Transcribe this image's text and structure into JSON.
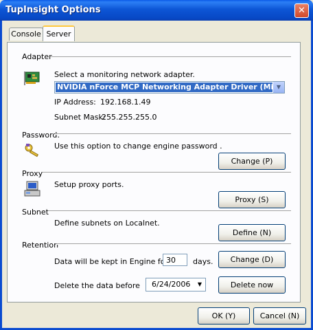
{
  "window": {
    "title": "TupInsight Options",
    "close_glyph": "✕"
  },
  "tabs": [
    {
      "label": "Console"
    },
    {
      "label": "Server"
    }
  ],
  "adapter": {
    "heading": "Adapter",
    "description": "Select a monitoring network adapter.",
    "selected": "NVIDIA nForce MCP Networking Adapter Driver (Micros",
    "ip_label": "IP Address:",
    "ip_value": "192.168.1.49",
    "mask_label": "Subnet Mask:",
    "mask_value": "255.255.255.0",
    "icon": "network-card-icon"
  },
  "password": {
    "heading": "Password:",
    "description": "Use this option to change engine password .",
    "button": "Change (P)",
    "icon": "key-icon"
  },
  "proxy": {
    "heading": "Proxy",
    "description": "Setup proxy ports.",
    "button": "Proxy (S)",
    "icon": "computer-icon"
  },
  "subnet": {
    "heading": "Subnet",
    "description": "Define subnets on Localnet.",
    "button": "Define (N)"
  },
  "retention": {
    "heading": "Retention",
    "kept_label": "Data will be kept in Engine for",
    "days_value": "30",
    "days_unit": "days.",
    "change_button": "Change (D)",
    "delete_label": "Delete the data before",
    "date_value": "6/24/2006",
    "delete_button": "Delete now"
  },
  "footer": {
    "ok": "OK (Y)",
    "cancel": "Cancel (N)"
  },
  "colors": {
    "titlebar": "#0D56D6",
    "face": "#ECE9D8",
    "selection": "#316AC5",
    "close": "#D14A2B"
  }
}
